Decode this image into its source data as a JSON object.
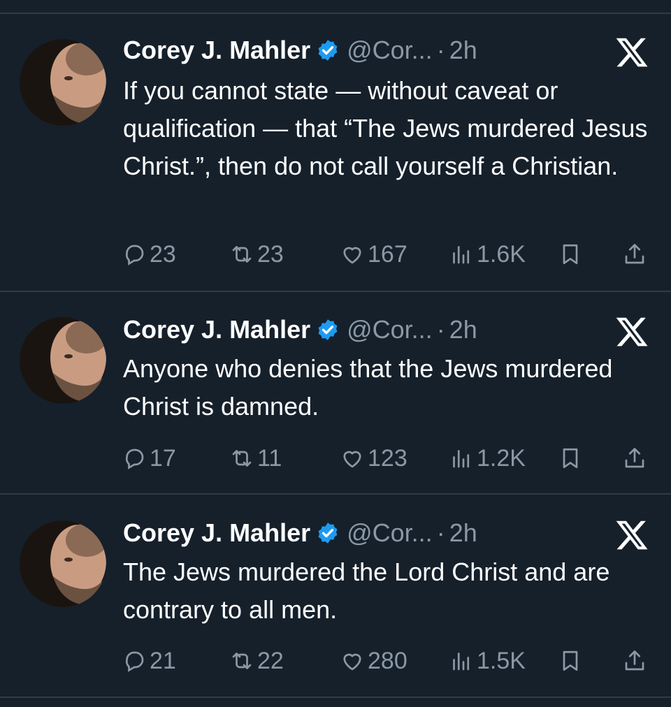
{
  "tweets": [
    {
      "name": "Corey J. Mahler",
      "handle": "@Cor...",
      "dot": "·",
      "time": "2h",
      "text": "If you cannot state — without caveat or qualification — that “The Jews murdered Jesus Christ.”, then do not call yourself a Christian.",
      "replies": "23",
      "reposts": "23",
      "likes": "167",
      "views": "1.6K"
    },
    {
      "name": "Corey J. Mahler",
      "handle": "@Cor...",
      "dot": "·",
      "time": "2h",
      "text": "Anyone who denies that the Jews murdered Christ is damned.",
      "replies": "17",
      "reposts": "11",
      "likes": "123",
      "views": "1.2K"
    },
    {
      "name": "Corey J. Mahler",
      "handle": "@Cor...",
      "dot": "·",
      "time": "2h",
      "text": "The Jews murdered the Lord Christ and are contrary to all men.",
      "replies": "21",
      "reposts": "22",
      "likes": "280",
      "views": "1.5K"
    }
  ],
  "icons": {
    "verified": "verified-badge-icon",
    "platform": "x-logo-icon",
    "reply": "reply-icon",
    "repost": "repost-icon",
    "like": "heart-icon",
    "views": "views-icon",
    "bookmark": "bookmark-icon",
    "share": "share-icon"
  },
  "colors": {
    "background": "#15202b",
    "text": "#ffffff",
    "muted": "#8b98a5",
    "verified": "#1d9bf0",
    "divider": "#2f3b47"
  }
}
